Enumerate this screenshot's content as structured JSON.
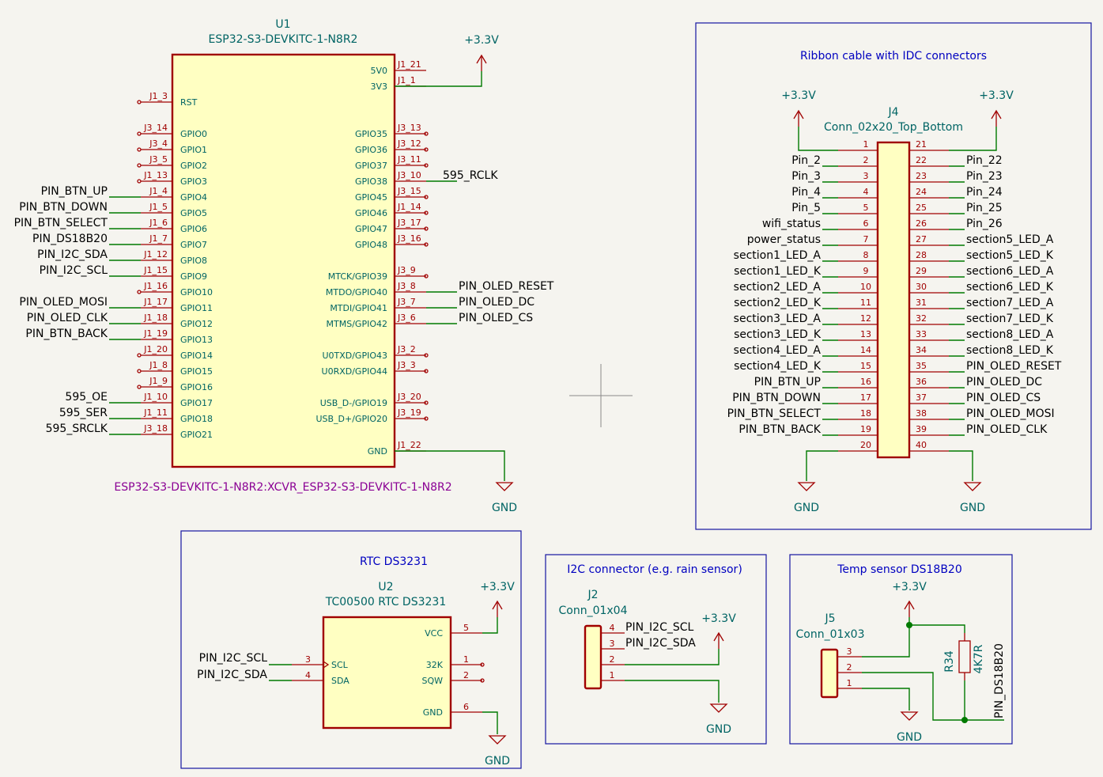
{
  "u1": {
    "ref": "U1",
    "value": "ESP32-S3-DEVKITC-1-N8R2",
    "footprint": "ESP32-S3-DEVKITC-1-N8R2:XCVR_ESP32-S3-DEVKITC-1-N8R2",
    "left_pins": [
      {
        "name": "RST",
        "num": "J1_3",
        "net": ""
      },
      {
        "name": "GPIO0",
        "num": "J3_14",
        "net": ""
      },
      {
        "name": "GPIO1",
        "num": "J3_4",
        "net": ""
      },
      {
        "name": "GPIO2",
        "num": "J3_5",
        "net": ""
      },
      {
        "name": "GPIO3",
        "num": "J1_13",
        "net": ""
      },
      {
        "name": "GPIO4",
        "num": "J1_4",
        "net": "PIN_BTN_UP"
      },
      {
        "name": "GPIO5",
        "num": "J1_5",
        "net": "PIN_BTN_DOWN"
      },
      {
        "name": "GPIO6",
        "num": "J1_6",
        "net": "PIN_BTN_SELECT"
      },
      {
        "name": "GPIO7",
        "num": "J1_7",
        "net": "PIN_DS18B20"
      },
      {
        "name": "GPIO8",
        "num": "J1_12",
        "net": "PIN_I2C_SDA"
      },
      {
        "name": "GPIO9",
        "num": "J1_15",
        "net": "PIN_I2C_SCL"
      },
      {
        "name": "GPIO10",
        "num": "J1_16",
        "net": ""
      },
      {
        "name": "GPIO11",
        "num": "J1_17",
        "net": "PIN_OLED_MOSI"
      },
      {
        "name": "GPIO12",
        "num": "J1_18",
        "net": "PIN_OLED_CLK"
      },
      {
        "name": "GPIO13",
        "num": "J1_19",
        "net": "PIN_BTN_BACK"
      },
      {
        "name": "GPIO14",
        "num": "J1_20",
        "net": ""
      },
      {
        "name": "GPIO15",
        "num": "J1_8",
        "net": ""
      },
      {
        "name": "GPIO16",
        "num": "J1_9",
        "net": ""
      },
      {
        "name": "GPIO17",
        "num": "J1_10",
        "net": "595_OE"
      },
      {
        "name": "GPIO18",
        "num": "J1_11",
        "net": "595_SER"
      },
      {
        "name": "GPIO21",
        "num": "J3_18",
        "net": "595_SRCLK"
      }
    ],
    "right_pins": [
      {
        "name": "5V0",
        "num": "J1_21",
        "net": ""
      },
      {
        "name": "3V3",
        "num": "J1_1",
        "net": ""
      },
      {
        "name": "GPIO35",
        "num": "J3_13",
        "net": ""
      },
      {
        "name": "GPIO36",
        "num": "J3_12",
        "net": ""
      },
      {
        "name": "GPIO37",
        "num": "J3_11",
        "net": ""
      },
      {
        "name": "GPIO38",
        "num": "J3_10",
        "net": "595_RCLK"
      },
      {
        "name": "GPIO45",
        "num": "J3_15",
        "net": ""
      },
      {
        "name": "GPIO46",
        "num": "J1_14",
        "net": ""
      },
      {
        "name": "GPIO47",
        "num": "J3_17",
        "net": ""
      },
      {
        "name": "GPIO48",
        "num": "J3_16",
        "net": ""
      },
      {
        "name": "MTCK/GPIO39",
        "num": "J3_9",
        "net": ""
      },
      {
        "name": "MTDO/GPIO40",
        "num": "J3_8",
        "net": "PIN_OLED_RESET"
      },
      {
        "name": "MTDI/GPIO41",
        "num": "J3_7",
        "net": "PIN_OLED_DC"
      },
      {
        "name": "MTMS/GPIO42",
        "num": "J3_6",
        "net": "PIN_OLED_CS"
      },
      {
        "name": "U0TXD/GPIO43",
        "num": "J3_2",
        "net": ""
      },
      {
        "name": "U0RXD/GPIO44",
        "num": "J3_3",
        "net": ""
      },
      {
        "name": "USB_D-/GPIO19",
        "num": "J3_20",
        "net": ""
      },
      {
        "name": "USB_D+/GPIO20",
        "num": "J3_19",
        "net": ""
      },
      {
        "name": "GND",
        "num": "J1_22",
        "net": ""
      }
    ],
    "power_label": "+3.3V",
    "gnd_label": "GND"
  },
  "j4": {
    "title": "Ribbon cable with IDC connectors",
    "ref": "J4",
    "value": "Conn_02x20_Top_Bottom",
    "power_left": "+3.3V",
    "power_right": "+3.3V",
    "gnd_left": "GND",
    "gnd_right": "GND",
    "left_nets": [
      "",
      "Pin_2",
      "Pin_3",
      "Pin_4",
      "Pin_5",
      "wifi_status",
      "power_status",
      "section1_LED_A",
      "section1_LED_K",
      "section2_LED_A",
      "section2_LED_K",
      "section3_LED_A",
      "section3_LED_K",
      "section4_LED_A",
      "section4_LED_K",
      "PIN_BTN_UP",
      "PIN_BTN_DOWN",
      "PIN_BTN_SELECT",
      "PIN_BTN_BACK",
      ""
    ],
    "right_nets": [
      "",
      "Pin_22",
      "Pin_23",
      "Pin_24",
      "Pin_25",
      "Pin_26",
      "section5_LED_A",
      "section5_LED_K",
      "section6_LED_A",
      "section6_LED_K",
      "section7_LED_A",
      "section7_LED_K",
      "section8_LED_A",
      "section8_LED_K",
      "PIN_OLED_RESET",
      "PIN_OLED_DC",
      "PIN_OLED_CS",
      "PIN_OLED_MOSI",
      "PIN_OLED_CLK",
      ""
    ],
    "left_nums": [
      "1",
      "2",
      "3",
      "4",
      "5",
      "6",
      "7",
      "8",
      "9",
      "10",
      "11",
      "12",
      "13",
      "14",
      "15",
      "16",
      "17",
      "18",
      "19",
      "20"
    ],
    "right_nums": [
      "21",
      "22",
      "23",
      "24",
      "25",
      "26",
      "27",
      "28",
      "29",
      "30",
      "31",
      "32",
      "33",
      "34",
      "35",
      "36",
      "37",
      "38",
      "39",
      "40"
    ]
  },
  "rtc": {
    "title": "RTC DS3231",
    "ref": "U2",
    "value": "TC00500 RTC DS3231",
    "pins": [
      {
        "name": "SCL",
        "num": "3",
        "net": "PIN_I2C_SCL"
      },
      {
        "name": "SDA",
        "num": "4",
        "net": "PIN_I2C_SDA"
      },
      {
        "name": "VCC",
        "num": "5"
      },
      {
        "name": "32K",
        "num": "1"
      },
      {
        "name": "SQW",
        "num": "2"
      },
      {
        "name": "GND",
        "num": "6"
      }
    ],
    "power_label": "+3.3V",
    "gnd_label": "GND"
  },
  "i2c": {
    "title": "I2C connector (e.g. rain sensor)",
    "ref": "J2",
    "value": "Conn_01x04",
    "pins": [
      "4",
      "3",
      "2",
      "1"
    ],
    "nets": [
      "PIN_I2C_SCL",
      "PIN_I2C_SDA"
    ],
    "power_label": "+3.3V",
    "gnd_label": "GND"
  },
  "temp": {
    "title": "Temp sensor DS18B20",
    "ref": "J5",
    "value": "Conn_01x03",
    "pins": [
      "3",
      "2",
      "1"
    ],
    "resistor_ref": "R34",
    "resistor_value": "4K7R",
    "net": "PIN_DS18B20",
    "power_label": "+3.3V",
    "gnd_label": "GND"
  }
}
